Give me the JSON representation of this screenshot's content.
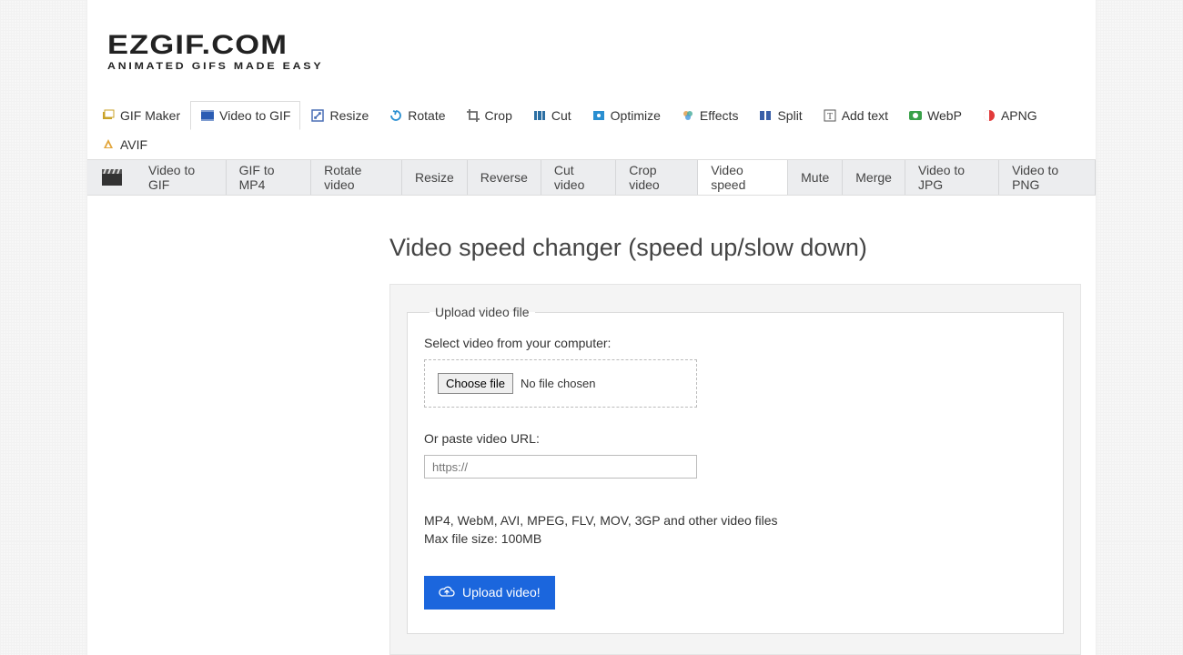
{
  "logo": {
    "main": "EZGIF.COM",
    "sub": "ANIMATED GIFS MADE EASY"
  },
  "nav_primary": [
    {
      "label": "GIF Maker",
      "icon": "layers-icon",
      "color": "#c9a227"
    },
    {
      "label": "Video to GIF",
      "icon": "film-icon",
      "color": "#2b5cb3",
      "active": true
    },
    {
      "label": "Resize",
      "icon": "resize-icon",
      "color": "#4a6fb5"
    },
    {
      "label": "Rotate",
      "icon": "rotate-icon",
      "color": "#2a8fd1"
    },
    {
      "label": "Crop",
      "icon": "crop-icon",
      "color": "#6a6a6a"
    },
    {
      "label": "Cut",
      "icon": "cut-icon",
      "color": "#2c6fa3"
    },
    {
      "label": "Optimize",
      "icon": "optimize-icon",
      "color": "#2a8fd1"
    },
    {
      "label": "Effects",
      "icon": "effects-icon",
      "color": "#cc7a2a"
    },
    {
      "label": "Split",
      "icon": "split-icon",
      "color": "#3a5fa8"
    },
    {
      "label": "Add text",
      "icon": "text-icon",
      "color": "#555"
    },
    {
      "label": "WebP",
      "icon": "webp-icon",
      "color": "#3aa14a"
    },
    {
      "label": "APNG",
      "icon": "apng-icon",
      "color": "#e23a3a"
    },
    {
      "label": "AVIF",
      "icon": "avif-icon",
      "color": "#e2a53a"
    }
  ],
  "nav_secondary": [
    {
      "label": "Video to GIF"
    },
    {
      "label": "GIF to MP4"
    },
    {
      "label": "Rotate video"
    },
    {
      "label": "Resize"
    },
    {
      "label": "Reverse"
    },
    {
      "label": "Cut video"
    },
    {
      "label": "Crop video"
    },
    {
      "label": "Video speed",
      "active": true
    },
    {
      "label": "Mute"
    },
    {
      "label": "Merge"
    },
    {
      "label": "Video to JPG"
    },
    {
      "label": "Video to PNG"
    }
  ],
  "page": {
    "title": "Video speed changer (speed up/slow down)",
    "fieldset_legend": "Upload video file",
    "select_label": "Select video from your computer:",
    "choose_file_label": "Choose file",
    "file_status": "No file chosen",
    "url_label": "Or paste video URL:",
    "url_placeholder": "https://",
    "hint_formats": "MP4, WebM, AVI, MPEG, FLV, MOV, 3GP and other video files",
    "hint_size": "Max file size: 100MB",
    "upload_button": "Upload video!"
  }
}
